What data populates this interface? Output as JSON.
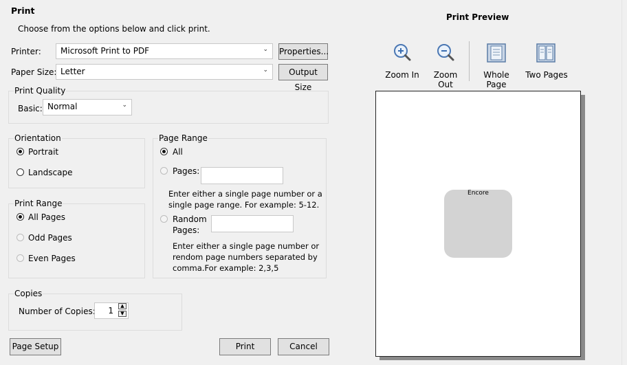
{
  "dialog": {
    "title": "Print",
    "instructions": "Choose from the options below and click print."
  },
  "printer": {
    "label": "Printer:",
    "value": "Microsoft Print to PDF",
    "properties_label": "Properties..."
  },
  "paper": {
    "label": "Paper Size:",
    "value": "Letter",
    "output_label": "Output Size"
  },
  "quality": {
    "title": "Print Quality",
    "basic_label": "Basic:",
    "value": "Normal"
  },
  "orientation": {
    "title": "Orientation",
    "portrait": "Portrait",
    "landscape": "Landscape",
    "selected": "Portrait"
  },
  "print_range": {
    "title": "Print Range",
    "all": "All Pages",
    "odd": "Odd Pages",
    "even": "Even Pages",
    "selected": "All Pages"
  },
  "page_range": {
    "title": "Page Range",
    "all": "All",
    "pages": "Pages:",
    "pages_value": "",
    "pages_hint_1": "Enter either a single page number or a",
    "pages_hint_2": "single page range. For example: 5-12.",
    "random_1": "Random",
    "random_2": "Pages:",
    "random_value": "",
    "random_hint_1": "Enter either a single page number or",
    "random_hint_2": "rendom page numbers separated by",
    "random_hint_3": "comma.For example: 2,3,5"
  },
  "copies": {
    "title": "Copies",
    "label": "Number of Copies:",
    "value": "1"
  },
  "buttons": {
    "page_setup": "Page Setup",
    "print": "Print",
    "cancel": "Cancel"
  },
  "preview": {
    "title": "Print Preview",
    "zoom_in": "Zoom In",
    "zoom_out": "Zoom Out",
    "whole_page": "Whole Page",
    "two_pages": "Two Pages",
    "shape_label": "Encore"
  }
}
